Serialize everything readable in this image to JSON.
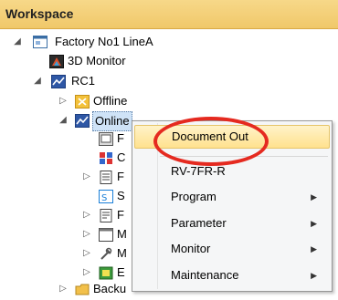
{
  "panel": {
    "title": "Workspace"
  },
  "tree": {
    "root_label": "Factory No1 LineA",
    "monitor3d_label": "3D Monitor",
    "rc1_label": "RC1",
    "offline_label": "Offline",
    "online_label": "Online",
    "backup_label": "Backu",
    "truncated": [
      "F",
      "C",
      "F",
      "S",
      "F",
      "M",
      "M",
      "E"
    ],
    "expanded_glyph": "◢",
    "collapsed_glyph": "▷"
  },
  "context_menu": {
    "items": [
      {
        "label": "Document Out",
        "highlighted": true,
        "submenu": false
      },
      {
        "label": "RV-7FR-R",
        "submenu": false
      },
      {
        "label": "Program",
        "submenu": true
      },
      {
        "label": "Parameter",
        "submenu": true
      },
      {
        "label": "Monitor",
        "submenu": true
      },
      {
        "label": "Maintenance",
        "submenu": true
      }
    ],
    "submenu_arrow": "▶"
  },
  "colors": {
    "header_bg": "#f0c86a",
    "highlight_bg": "#ffe18e",
    "annotation_circle": "#e52a20",
    "selection_bg": "#cfe3f7"
  }
}
